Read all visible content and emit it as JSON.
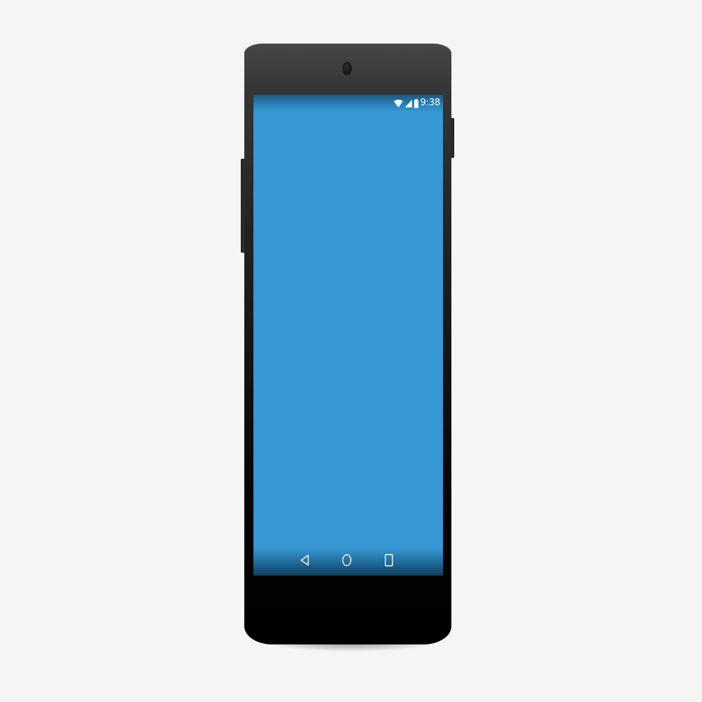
{
  "device": {
    "model": "phone",
    "screen_color": "#3799d4",
    "frame_color": "#1a1a1a"
  },
  "status_bar": {
    "time": "9:38",
    "icons": [
      "wifi-icon",
      "cell-signal-icon",
      "battery-icon"
    ],
    "icon_color": "#ffffff"
  },
  "nav_bar": {
    "buttons": [
      "back-icon",
      "home-icon",
      "recents-icon"
    ],
    "icon_color": "#ffffff"
  }
}
